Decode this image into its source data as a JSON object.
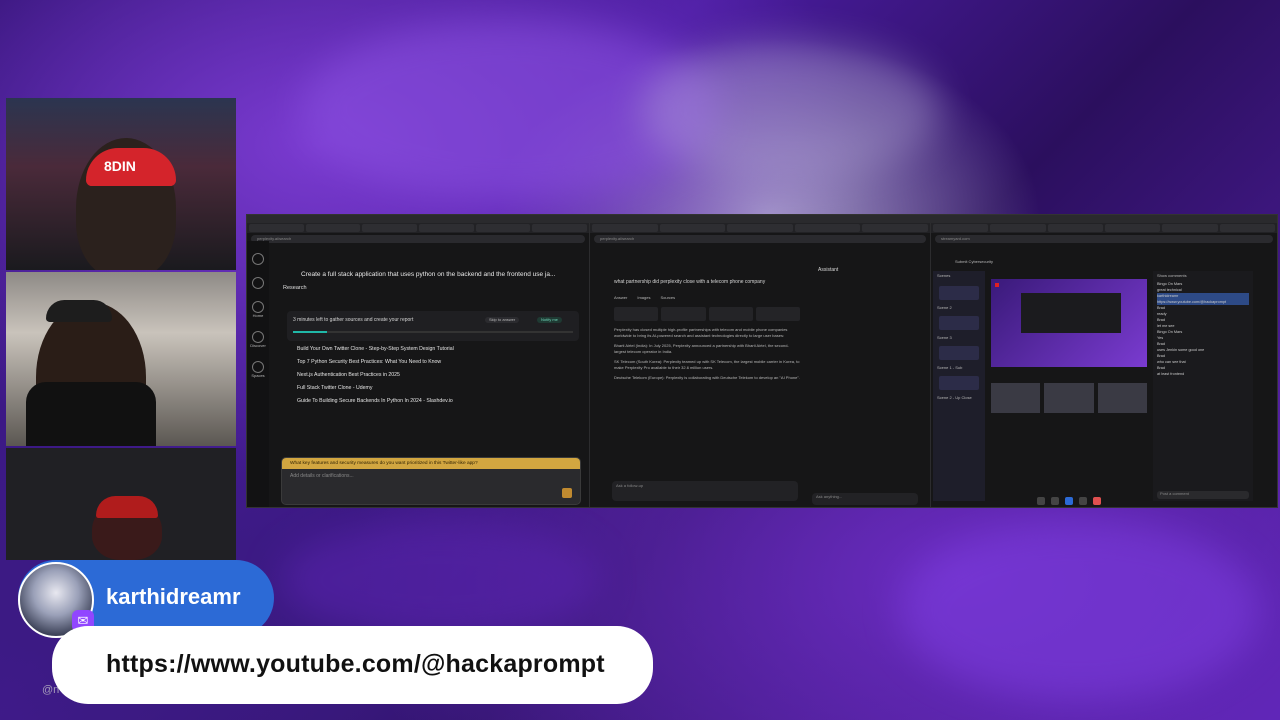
{
  "stream": {
    "username": "karthidreamr",
    "link": "https://www.youtube.com/@hackaprompt",
    "watermark": "@n"
  },
  "screen_share": {
    "left_pane": {
      "title": "Create a full stack application that uses python on the backend and the frontend use ja...",
      "mode": "Research",
      "progress_text": "3 minutes left to gather sources and create your report",
      "skip_label": "Skip to answer",
      "notify_label": "Notify me",
      "results": [
        "Build Your Own Twitter Clone - Step-by-Step System Design Tutorial",
        "Top 7 Python Security Best Practices: What You Need to Know",
        "Next.js Authentication Best Practices in 2025",
        "Full Stack Twitter Clone - Udemy",
        "Guide To Building Secure Backends In Python In 2024 - Slashdev.io"
      ],
      "followup_question": "What key features and security measures do you want prioritized in this Twitter-like app?",
      "input_placeholder": "Add details or clarifications...",
      "sidebar": [
        "Home",
        "Discover",
        "Spaces"
      ]
    },
    "middle_pane": {
      "query": "what partnership did perplexity close with a telecom phone company",
      "assistant_label": "Assistant",
      "tabs": [
        "Answer",
        "Images",
        "Sources"
      ],
      "paragraphs": [
        "Perplexity has closed multiple high-profile partnerships with telecom and mobile phone companies worldwide to bring its AI-powered search and assistant technologies directly to large user bases:",
        "Bharti Airtel (India): In July 2025, Perplexity announced a partnership with Bharti Airtel, the second-largest telecom operator in India.",
        "SK Telecom (South Korea): Perplexity teamed up with SK Telecom, the largest mobile carrier in Korea, to make Perplexity Pro available to their 32.6 million users.",
        "Deutsche Telekom (Europe): Perplexity is collaborating with Deutsche Telekom to develop an \"AI Phone\"."
      ],
      "input_placeholder": "Ask a follow-up",
      "assistant_placeholder": "Ask anything..."
    },
    "right_pane": {
      "title": "Submit Cybersecurity",
      "scenes_label": "Scenes",
      "scenes": [
        "Scene 2",
        "Scene 3",
        "Scene 1 - Sub",
        "Scene 2 - Up Close"
      ],
      "chat_header": "Show comments",
      "chat_messages": [
        {
          "user": "Bingo On Mars",
          "text": "great technical"
        },
        {
          "user": "karthidreamr",
          "text": "https://www.youtube.com/@hackaprompt"
        },
        {
          "user": "Brad",
          "text": "ready"
        },
        {
          "user": "Brad",
          "text": "let me see"
        },
        {
          "user": "Bingo On Mars",
          "text": "Yes"
        },
        {
          "user": "Brad",
          "text": "uses Jenkin some good one"
        },
        {
          "user": "Brad",
          "text": "who can see that"
        },
        {
          "user": "Brad",
          "text": "at least frontend"
        }
      ],
      "chat_input": "Post a comment"
    }
  },
  "colors": {
    "accent_blue": "#2c6ad6",
    "twitch_purple": "#9146ff",
    "followup_gold": "#d2a640"
  }
}
